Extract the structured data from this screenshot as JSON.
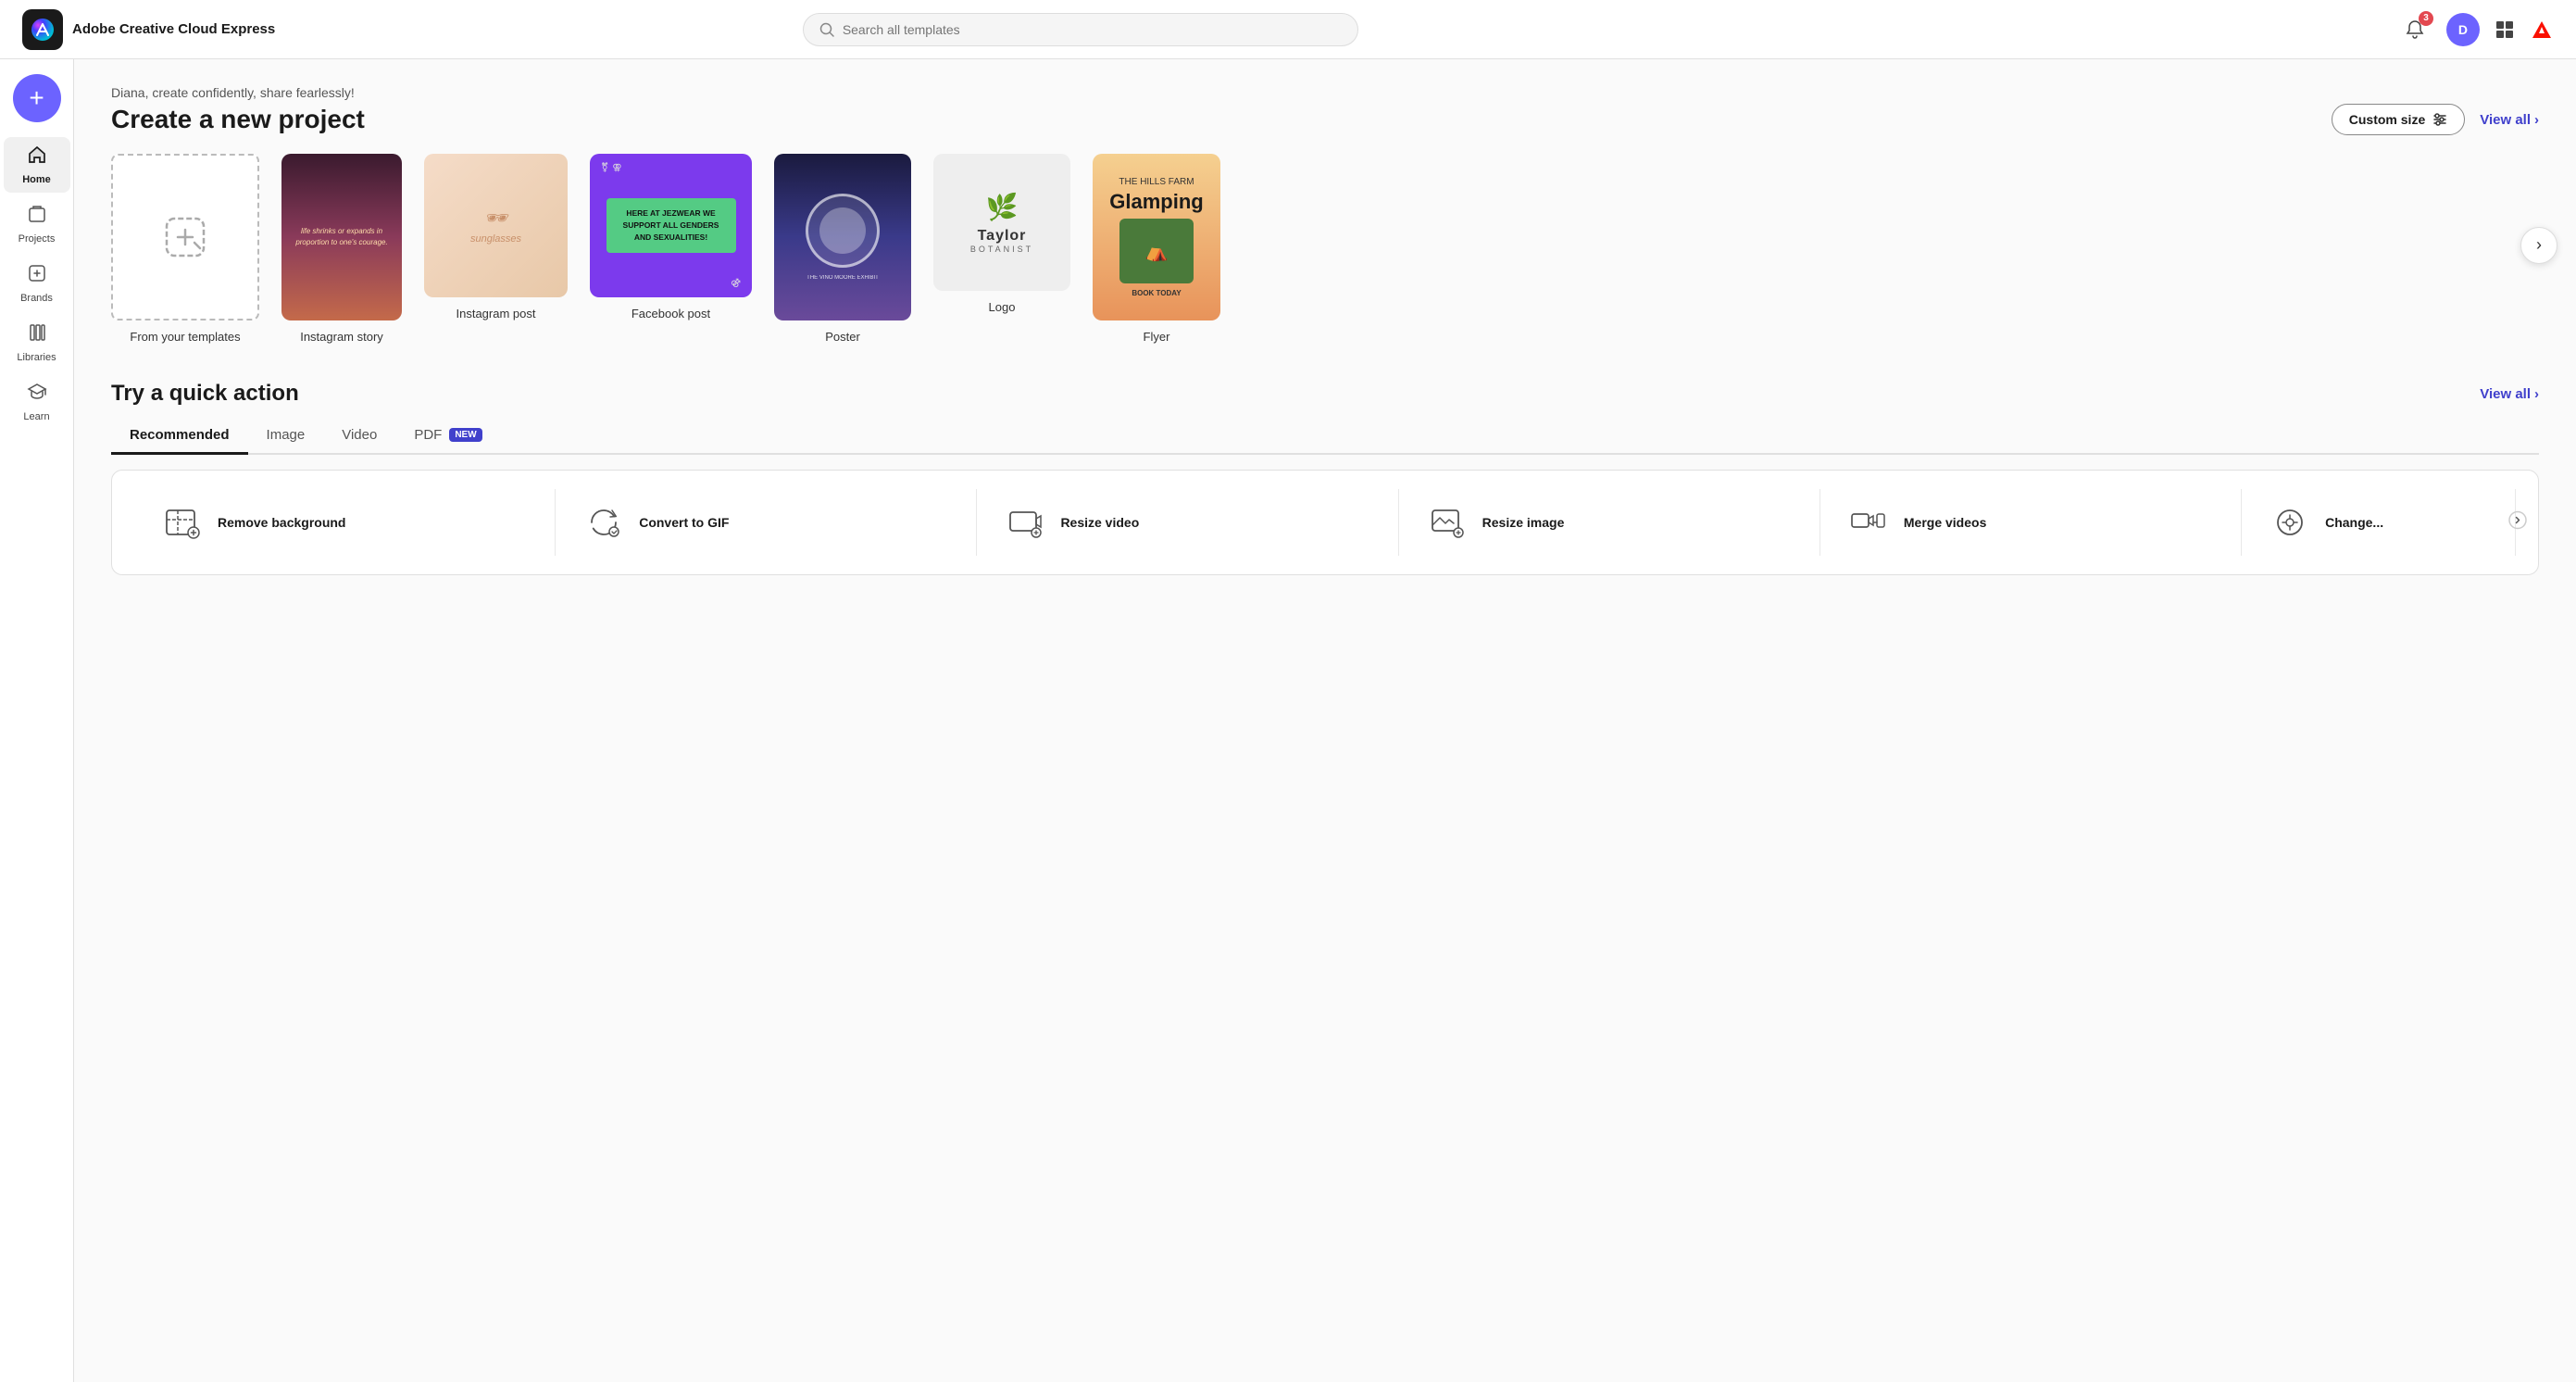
{
  "app": {
    "name": "Adobe Creative Cloud Express",
    "logo_bg": "#1a1a1a"
  },
  "header": {
    "search_placeholder": "Search all templates",
    "notif_badge": "3",
    "avatar_text": "D"
  },
  "sidebar": {
    "create_label": "+",
    "items": [
      {
        "id": "home",
        "label": "Home",
        "active": true,
        "icon": "🏠"
      },
      {
        "id": "projects",
        "label": "Projects",
        "active": false,
        "icon": "📁"
      },
      {
        "id": "brands",
        "label": "Brands",
        "active": false,
        "icon": "🏷"
      },
      {
        "id": "libraries",
        "label": "Libraries",
        "active": false,
        "icon": "📚"
      },
      {
        "id": "learn",
        "label": "Learn",
        "active": false,
        "icon": "📖"
      }
    ]
  },
  "main": {
    "greeting": "Diana, create confidently, share fearlessly!",
    "create_section": {
      "title": "Create a new project",
      "custom_size_label": "Custom size",
      "view_all_label": "View all"
    },
    "from_templates_label": "From your templates",
    "template_cards": [
      {
        "id": "instagram-story",
        "label": "Instagram story",
        "type": "story"
      },
      {
        "id": "instagram-post",
        "label": "Instagram post",
        "type": "square"
      },
      {
        "id": "facebook-post",
        "label": "Facebook post",
        "type": "fb"
      },
      {
        "id": "poster",
        "label": "Poster",
        "type": "poster"
      },
      {
        "id": "logo",
        "label": "Logo",
        "type": "logo"
      },
      {
        "id": "flyer",
        "label": "Flyer",
        "type": "flyer"
      }
    ],
    "quick_action": {
      "title": "Try a quick action",
      "view_all_label": "View all",
      "tabs": [
        {
          "id": "recommended",
          "label": "Recommended",
          "active": true,
          "badge": null
        },
        {
          "id": "image",
          "label": "Image",
          "active": false,
          "badge": null
        },
        {
          "id": "video",
          "label": "Video",
          "active": false,
          "badge": null
        },
        {
          "id": "pdf",
          "label": "PDF",
          "active": false,
          "badge": "NEW"
        }
      ],
      "actions": [
        {
          "id": "remove-bg",
          "label": "Remove background",
          "icon": "🖼"
        },
        {
          "id": "convert-gif",
          "label": "Convert to GIF",
          "icon": "🔄"
        },
        {
          "id": "resize-video",
          "label": "Resize video",
          "icon": "🎬"
        },
        {
          "id": "resize-image",
          "label": "Resize image",
          "icon": "🖼"
        },
        {
          "id": "merge-videos",
          "label": "Merge videos",
          "icon": "🎞"
        },
        {
          "id": "change",
          "label": "Change...",
          "icon": "⚙"
        }
      ]
    }
  },
  "colors": {
    "accent": "#4040cc",
    "brand_purple": "#6c63ff",
    "danger": "#e34850"
  }
}
